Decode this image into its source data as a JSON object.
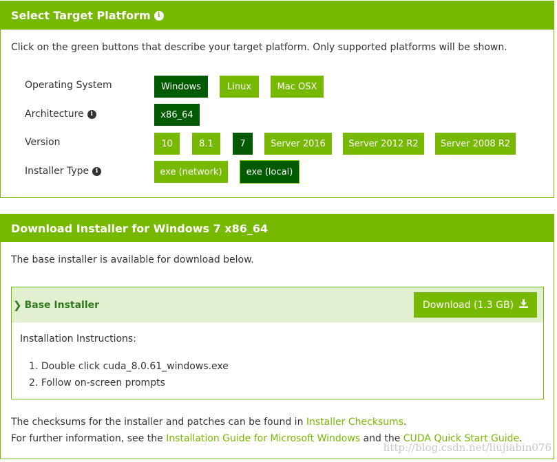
{
  "platform": {
    "title": "Select Target Platform",
    "description": "Click on the green buttons that describe your target platform. Only supported platforms will be shown.",
    "os": {
      "label": "Operating System",
      "options": [
        "Windows",
        "Linux",
        "Mac OSX"
      ],
      "selected": "Windows"
    },
    "arch": {
      "label": "Architecture",
      "options": [
        "x86_64"
      ],
      "selected": "x86_64"
    },
    "version": {
      "label": "Version",
      "options": [
        "10",
        "8.1",
        "7",
        "Server 2016",
        "Server 2012 R2",
        "Server 2008 R2"
      ],
      "selected": "7"
    },
    "installer": {
      "label": "Installer Type",
      "options": [
        "exe (network)",
        "exe (local)"
      ],
      "selected": "exe (local)"
    }
  },
  "download": {
    "title": "Download Installer for Windows 7 x86_64",
    "description": "The base installer is available for download below.",
    "base_label": "Base Installer",
    "button_label": "Download (1.3 GB)",
    "instructions_title": "Installation Instructions:",
    "steps": [
      "Double click cuda_8.0.61_windows.exe",
      "Follow on-screen prompts"
    ],
    "checksum_text": "The checksums for the installer and patches can be found in",
    "checksum_link": "Installer Checksums",
    "checksum_end": ".",
    "info_text": "For further information, see the",
    "guide_link": "Installation Guide for Microsoft Windows",
    "and_text": "and the",
    "quickstart_link": "CUDA Quick Start Guide",
    "info_end": "."
  },
  "watermark": "http://blog.csdn.net/liujiabin076",
  "colors": {
    "accent": "#76b900",
    "selected": "#005a00",
    "inner_header": "#e2f0cf"
  },
  "icons": {
    "info": "info-circle-icon",
    "chevron": "chevron-right-icon",
    "download": "download-icon"
  }
}
